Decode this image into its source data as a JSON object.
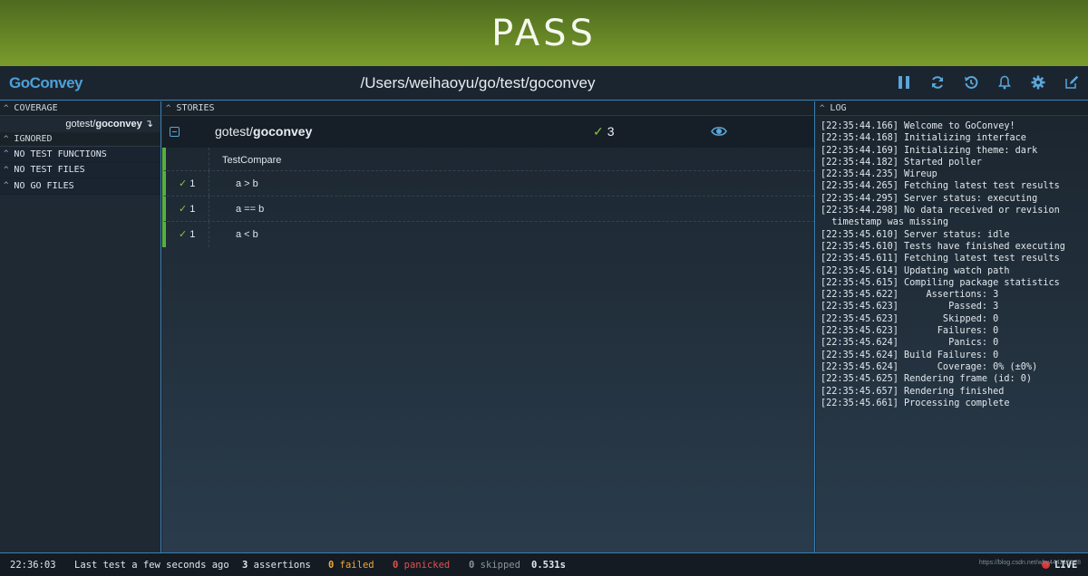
{
  "banner": {
    "status": "PASS"
  },
  "header": {
    "brand": "GoConvey",
    "path": "/Users/weihaoyu/go/test/goconvey"
  },
  "toolbar": {
    "icons": [
      "pause-icon",
      "refresh-icon",
      "history-icon",
      "notifications-icon",
      "settings-icon",
      "edit-icon"
    ]
  },
  "left": {
    "coverage_title": "COVERAGE",
    "coverage_item_prefix": "gotest/",
    "coverage_item_name": "goconvey",
    "coverage_item_suffix": "↴",
    "ignored_title": "IGNORED",
    "rows": [
      "NO TEST FUNCTIONS",
      "NO TEST FILES",
      "NO GO FILES"
    ]
  },
  "stories": {
    "title": "STORIES",
    "package_prefix": "gotest/",
    "package_name": "goconvey",
    "package_check": "✓",
    "package_count": "3",
    "test_name": "TestCompare",
    "assertions": [
      {
        "check": "✓",
        "count": "1",
        "label": "a > b"
      },
      {
        "check": "✓",
        "count": "1",
        "label": "a == b"
      },
      {
        "check": "✓",
        "count": "1",
        "label": "a < b"
      }
    ]
  },
  "log": {
    "title": "LOG",
    "lines": [
      "[22:35:44.166] Welcome to GoConvey!",
      "[22:35:44.168] Initializing interface",
      "[22:35:44.169] Initializing theme: dark",
      "[22:35:44.182] Started poller",
      "[22:35:44.235] Wireup",
      "[22:35:44.265] Fetching latest test results",
      "[22:35:44.295] Server status: executing",
      "[22:35:44.298] No data received or revision",
      "  timestamp was missing",
      "[22:35:45.610] Server status: idle",
      "[22:35:45.610] Tests have finished executing",
      "[22:35:45.611] Fetching latest test results",
      "[22:35:45.614] Updating watch path",
      "[22:35:45.615] Compiling package statistics",
      "[22:35:45.622]     Assertions: 3",
      "[22:35:45.623]         Passed: 3",
      "[22:35:45.623]        Skipped: 0",
      "[22:35:45.623]       Failures: 0",
      "[22:35:45.624]         Panics: 0",
      "[22:35:45.624] Build Failures: 0",
      "[22:35:45.624]       Coverage: 0% (±0%)",
      "[22:35:45.625] Rendering frame (id: 0)",
      "[22:35:45.657] Rendering finished",
      "[22:35:45.661] Processing complete"
    ]
  },
  "footer": {
    "time": "22:36:03",
    "last_test": "Last test a few seconds ago",
    "assertions_count": "3",
    "assertions_label": "assertions",
    "failed_count": "0",
    "failed_label": "failed",
    "panicked_count": "0",
    "panicked_label": "panicked",
    "skipped_count": "0",
    "skipped_label": "skipped",
    "duration": "0.531s",
    "live": "LIVE",
    "watermark": "https://blog.csdn.net/why444216978"
  },
  "colors": {
    "pass_green": "#7a9c2c",
    "accent_blue": "#3a7fb3",
    "check_green": "#8cc04b",
    "failed_orange": "#f0a63a",
    "panicked_red": "#e0514f"
  }
}
